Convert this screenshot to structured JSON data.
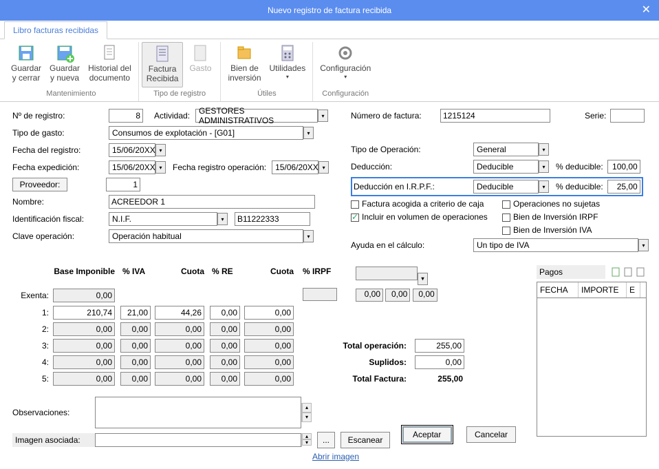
{
  "title": "Nuevo registro de factura recibida",
  "tab": "Libro facturas recibidas",
  "ribbon": {
    "grp1": {
      "label": "Mantenimiento",
      "btn_guardar_cerrar": "Guardar\ny cerrar",
      "btn_guardar_nueva": "Guardar\ny nueva",
      "btn_historial": "Historial del\ndocumento"
    },
    "grp2": {
      "label": "Tipo de registro",
      "btn_factura": "Factura\nRecibida",
      "btn_gasto": "Gasto"
    },
    "grp3": {
      "label": "Útiles",
      "btn_bien": "Bien de\ninversión",
      "btn_util": "Utilidades"
    },
    "grp4": {
      "label": "Configuración",
      "btn_config": "Configuración"
    }
  },
  "form": {
    "nregistro_l": "Nº de registro:",
    "nregistro": "8",
    "actividad_l": "Actividad:",
    "actividad": "GESTORES ADMINISTRATIVOS",
    "tipogasto_l": "Tipo de gasto:",
    "tipogasto": "Consumos de explotación - [G01]",
    "fecharegistro_l": "Fecha del registro:",
    "fecharegistro": "15/06/20XX",
    "fechaexp_l": "Fecha expedición:",
    "fechaexp": "15/06/20XX",
    "fecharegop_l": "Fecha registro operación:",
    "fecharegop": "15/06/20XX",
    "proveedor_l": "Proveedor:",
    "proveedor": "1",
    "nombre_l": "Nombre:",
    "nombre": "ACREEDOR 1",
    "idfiscal_l": "Identificación fiscal:",
    "idfiscal_tipo": "N.I.F.",
    "idfiscal_num": "B11222333",
    "claveop_l": "Clave operación:",
    "claveop": "Operación habitual",
    "numfactura_l": "Número de factura:",
    "numfactura": "1215124",
    "serie_l": "Serie:",
    "serie": "",
    "tipoop_l": "Tipo de Operación:",
    "tipoop": "General",
    "deduccion_l": "Deducción:",
    "deduccion": "Deducible",
    "pded_l": "% deducible:",
    "pded": "100,00",
    "dedirpf_l": "Deducción en I.R.P.F.:",
    "dedirpf": "Deducible",
    "pded2_l": "% deducible:",
    "pded2": "25,00",
    "chk_caja": "Factura acogida a criterio de caja",
    "chk_nosujetas": "Operaciones no sujetas",
    "chk_volumen": "Incluir en  volumen de operaciones",
    "chk_bi_irpf": "Bien de Inversión IRPF",
    "chk_bi_iva": "Bien de Inversión IVA",
    "ayuda_l": "Ayuda en el cálculo:",
    "ayuda": "Un tipo de IVA"
  },
  "grid": {
    "h_base": "Base Imponible",
    "h_piva": "% IVA",
    "h_cuota": "Cuota",
    "h_pre": "% RE",
    "h_cuota2": "Cuota",
    "h_pirpf": "% IRPF",
    "exenta_l": "Exenta:",
    "r1_l": "1:",
    "r2_l": "2:",
    "r3_l": "3:",
    "r4_l": "4:",
    "r5_l": "5:",
    "exenta_base": "0,00",
    "r1": {
      "base": "210,74",
      "piva": "21,00",
      "cuota": "44,26",
      "pre": "0,00",
      "cuota2": "0,00"
    },
    "r2": {
      "base": "0,00",
      "piva": "0,00",
      "cuota": "0,00",
      "pre": "0,00",
      "cuota2": "0,00"
    },
    "r3": {
      "base": "0,00",
      "piva": "0,00",
      "cuota": "0,00",
      "pre": "0,00",
      "cuota2": "0,00"
    },
    "r4": {
      "base": "0,00",
      "piva": "0,00",
      "cuota": "0,00",
      "pre": "0,00",
      "cuota2": "0,00"
    },
    "r5": {
      "base": "0,00",
      "piva": "0,00",
      "cuota": "0,00",
      "pre": "0,00",
      "cuota2": "0,00"
    },
    "irpf_cuota": "0,00",
    "irpf_cuota2": "0,00",
    "irpf_cuota3": "0,00",
    "totop_l": "Total operación:",
    "totop": "255,00",
    "supl_l": "Suplidos:",
    "supl": "0,00",
    "totfac_l": "Total Factura:",
    "totfac": "255,00"
  },
  "obs_l": "Observaciones:",
  "img_l": "Imagen asociada:",
  "btn_browse": "...",
  "btn_scan": "Escanear",
  "link_abrir": "Abrir imagen",
  "btn_aceptar": "Aceptar",
  "btn_cancelar": "Cancelar",
  "pagos_l": "Pagos",
  "pagos_fecha": "FECHA",
  "pagos_importe": "IMPORTE",
  "pagos_e": "E"
}
